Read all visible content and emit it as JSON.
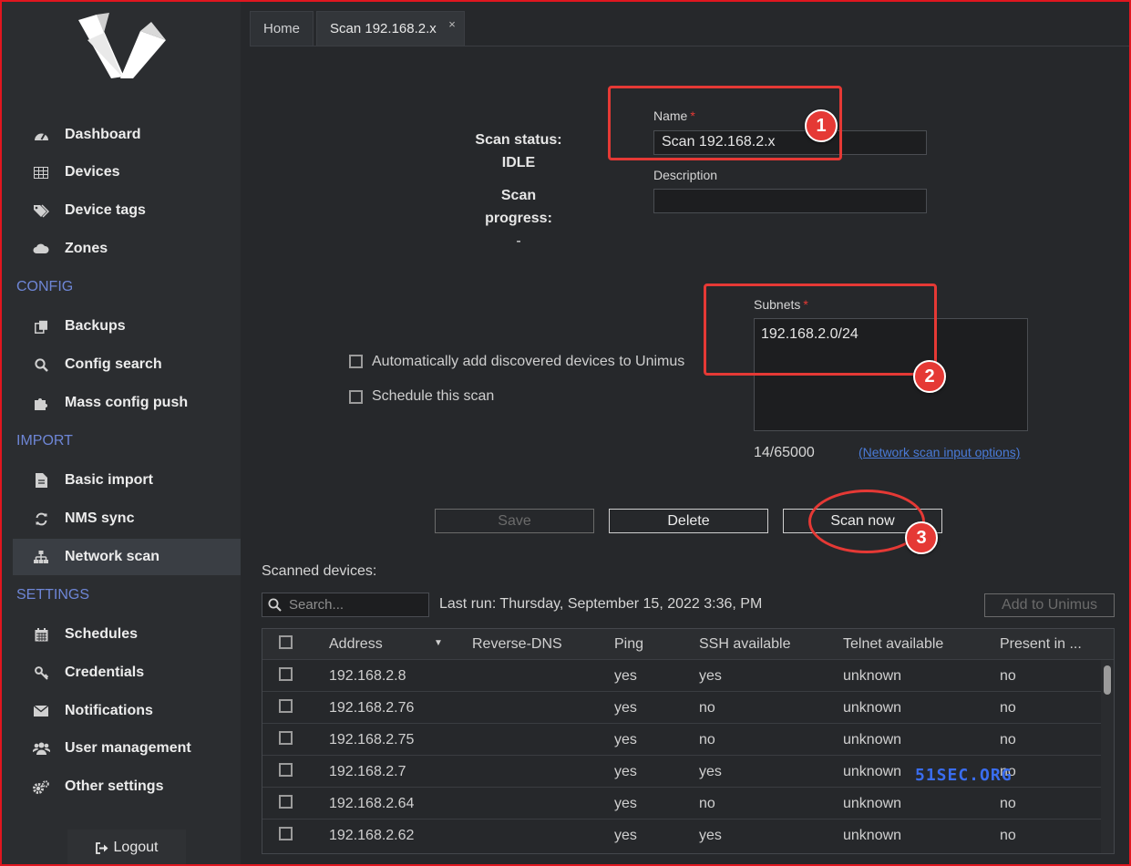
{
  "sidebar": {
    "items": [
      {
        "label": "Dashboard",
        "icon": "dashboard-icon"
      },
      {
        "label": "Devices",
        "icon": "table-icon"
      },
      {
        "label": "Device tags",
        "icon": "tags-icon"
      },
      {
        "label": "Zones",
        "icon": "cloud-icon"
      }
    ],
    "config_header": "CONFIG",
    "config_items": [
      {
        "label": "Backups",
        "icon": "copy-icon"
      },
      {
        "label": "Config search",
        "icon": "search-icon"
      },
      {
        "label": "Mass config push",
        "icon": "puzzle-icon"
      }
    ],
    "import_header": "IMPORT",
    "import_items": [
      {
        "label": "Basic import",
        "icon": "file-icon"
      },
      {
        "label": "NMS sync",
        "icon": "sync-icon"
      },
      {
        "label": "Network scan",
        "icon": "sitemap-icon"
      }
    ],
    "settings_header": "SETTINGS",
    "settings_items": [
      {
        "label": "Schedules",
        "icon": "calendar-icon"
      },
      {
        "label": "Credentials",
        "icon": "key-icon"
      },
      {
        "label": "Notifications",
        "icon": "envelope-icon"
      },
      {
        "label": "User management",
        "icon": "users-icon"
      },
      {
        "label": "Other settings",
        "icon": "cogs-icon"
      }
    ],
    "logout_label": "Logout"
  },
  "tabs": [
    {
      "label": "Home"
    },
    {
      "label": "Scan 192.168.2.x",
      "close": "×"
    }
  ],
  "status": {
    "status_label": "Scan status:",
    "status_value": "IDLE",
    "progress_label": "Scan progress:",
    "progress_value": "-"
  },
  "form": {
    "name_label": "Name",
    "required_mark": "*",
    "name_value": "Scan 192.168.2.x",
    "description_label": "Description",
    "description_value": "",
    "subnets_label": "Subnets",
    "subnets_value": "192.168.2.0/24",
    "subnet_count": "14/65000",
    "input_options_link": "(Network scan input options)",
    "auto_add_label": "Automatically add discovered devices to Unimus",
    "schedule_label": "Schedule this scan"
  },
  "buttons": {
    "save": "Save",
    "delete": "Delete",
    "scan_now": "Scan now",
    "add_to_unimus": "Add to Unimus"
  },
  "annotations": {
    "one": "1",
    "two": "2",
    "three": "3"
  },
  "scanned": {
    "title": "Scanned devices:",
    "search_placeholder": "Search...",
    "last_run": "Last run: Thursday, September 15, 2022 3:36, PM",
    "columns": [
      "Address",
      "Reverse-DNS",
      "Ping",
      "SSH available",
      "Telnet available",
      "Present in ..."
    ],
    "rows": [
      {
        "address": "192.168.2.8",
        "dns": "",
        "ping": "yes",
        "ssh": "yes",
        "telnet": "unknown",
        "present": "no"
      },
      {
        "address": "192.168.2.76",
        "dns": "",
        "ping": "yes",
        "ssh": "no",
        "telnet": "unknown",
        "present": "no"
      },
      {
        "address": "192.168.2.75",
        "dns": "",
        "ping": "yes",
        "ssh": "no",
        "telnet": "unknown",
        "present": "no"
      },
      {
        "address": "192.168.2.7",
        "dns": "",
        "ping": "yes",
        "ssh": "yes",
        "telnet": "unknown",
        "present": "no"
      },
      {
        "address": "192.168.2.64",
        "dns": "",
        "ping": "yes",
        "ssh": "no",
        "telnet": "unknown",
        "present": "no"
      },
      {
        "address": "192.168.2.62",
        "dns": "",
        "ping": "yes",
        "ssh": "yes",
        "telnet": "unknown",
        "present": "no"
      }
    ]
  },
  "watermark": "51SEC.ORG",
  "colors": {
    "accent_red": "#e53935",
    "section_blue": "#6e86d6",
    "link_blue": "#4a7bd8"
  }
}
